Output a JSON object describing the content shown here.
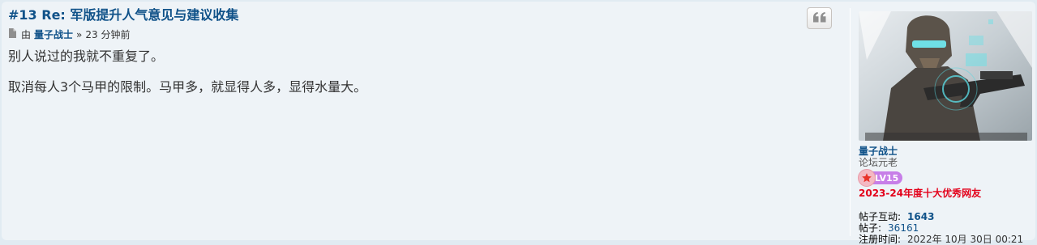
{
  "post": {
    "title": "#13 Re: 军版提升人气意见与建议收集",
    "meta": {
      "by": "由",
      "author": "量子战士",
      "separator": "»",
      "time": "23 分钟前"
    },
    "paragraphs": [
      "别人说过的我就不重复了。",
      "取消每人3个马甲的限制。马甲多，就显得人多，显得水量大。"
    ]
  },
  "profile": {
    "username": "量子战士",
    "rank": "论坛元老",
    "level": "LV15",
    "award": "2023-24年度十大优秀网友",
    "stats": [
      {
        "label": "帖子互动:",
        "value": "1643"
      },
      {
        "label": "帖子:",
        "value": "36161"
      },
      {
        "label": "注册时间:",
        "value": "2022年 10月 30日 00:21"
      }
    ]
  },
  "icons": {
    "quote": "quote-icon",
    "post": "file-icon",
    "level_star": "star-icon"
  },
  "colors": {
    "link": "#105289",
    "award": "#e3001a",
    "level_badge": "#c77ee8",
    "post_bg": "#eef3f7"
  }
}
